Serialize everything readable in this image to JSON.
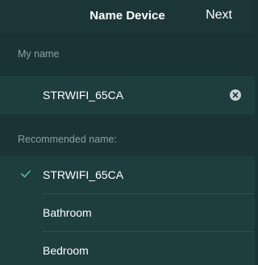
{
  "navbar": {
    "title": "Name Device",
    "next_label": "Next"
  },
  "my_name": {
    "header": "My name",
    "value": "STRWIFI_65CA",
    "clear_icon": "clear-circle-icon"
  },
  "recommended": {
    "header": "Recommended name:",
    "items": [
      {
        "label": "STRWIFI_65CA",
        "selected": true
      },
      {
        "label": "Bathroom",
        "selected": false
      },
      {
        "label": "Bedroom",
        "selected": false
      }
    ],
    "check_icon": "checkmark-icon"
  },
  "colors": {
    "accent": "#5fb9a6",
    "background": "#1a3335",
    "row_background": "#1e3d3f"
  }
}
